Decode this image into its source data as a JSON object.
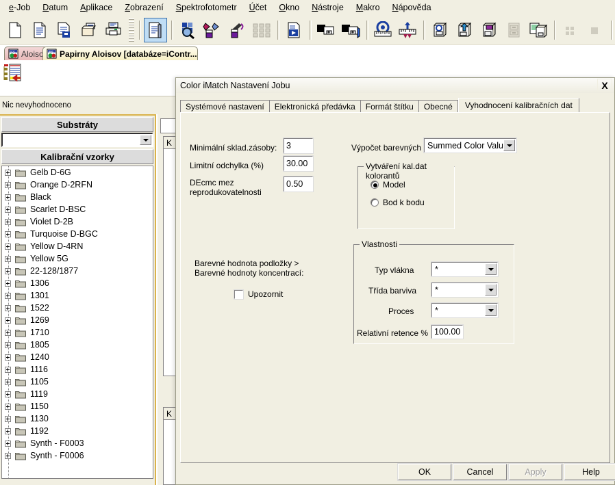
{
  "menubar": {
    "items": [
      {
        "label": "e-Job",
        "accel": "e"
      },
      {
        "label": "Datum",
        "accel": "D"
      },
      {
        "label": "Aplikace",
        "accel": "A"
      },
      {
        "label": "Zobrazení",
        "accel": "Z"
      },
      {
        "label": "Spektrofotometr",
        "accel": "S"
      },
      {
        "label": "Účet",
        "accel": "Ú"
      },
      {
        "label": "Okno",
        "accel": "O"
      },
      {
        "label": "Nástroje",
        "accel": "N"
      },
      {
        "label": "Makro",
        "accel": "M"
      },
      {
        "label": "Nápověda",
        "accel": "N"
      }
    ]
  },
  "toolbar": {
    "buttons": [
      {
        "icon": "new-document-icon",
        "selected": false
      },
      {
        "icon": "open-document-icon",
        "selected": false
      },
      {
        "icon": "save-document-icon",
        "selected": false
      },
      {
        "icon": "print-preview-icon",
        "selected": false
      },
      {
        "icon": "print-icon",
        "selected": false
      },
      {
        "icon": "job-document-icon",
        "selected": true
      },
      {
        "icon": "color-search-icon",
        "selected": false
      },
      {
        "icon": "color-mix-icon",
        "selected": false
      },
      {
        "icon": "pipette-sample-icon",
        "selected": false
      },
      {
        "icon": "columns-grid-icon",
        "selected": false
      },
      {
        "icon": "run-document-icon",
        "selected": false
      },
      {
        "icon": "monitor-measure-icon",
        "selected": false
      },
      {
        "icon": "monitor-edit-icon",
        "selected": false
      },
      {
        "icon": "target-ruler-icon",
        "selected": false
      },
      {
        "icon": "tolerance-ruler-icon",
        "selected": false
      },
      {
        "icon": "database-target-icon",
        "selected": false
      },
      {
        "icon": "database-import-icon",
        "selected": false
      },
      {
        "icon": "database-color-icon",
        "selected": false
      },
      {
        "icon": "cabinet-icon",
        "selected": false
      },
      {
        "icon": "report-database-icon",
        "selected": false
      },
      {
        "icon": "grid-small-icon",
        "selected": false
      },
      {
        "icon": "grid-block-icon",
        "selected": false
      },
      {
        "icon": "mail-icon",
        "selected": false
      }
    ]
  },
  "doctabs": [
    {
      "label": "Aloisov",
      "active": false,
      "icon": "doc-globe-icon"
    },
    {
      "label": "Papirny Aloisov [databáze=iContr...",
      "active": true,
      "icon": "doc-globe-icon"
    }
  ],
  "status": {
    "text": "Nic nevyhodnoceno"
  },
  "leftpanel": {
    "substrates": {
      "header": "Substráty",
      "selected_value": "",
      "placeholder": ""
    },
    "calibration": {
      "header": "Kalibrační vzorky",
      "items": [
        "Gelb D-6G",
        "Orange D-2RFN",
        "Black",
        "Scarlet D-BSC",
        "Violet D-2B",
        "Turquoise D-BGC",
        "Yellow D-4RN",
        "Yellow 5G",
        "22-128/1877",
        "1306",
        "1301",
        "1522",
        "1269",
        "1710",
        "1805",
        "1240",
        "1116",
        "1105",
        "1119",
        "1150",
        "1130",
        "1192",
        "Synth - F0003",
        "Synth - F0006"
      ]
    }
  },
  "background_panels": {
    "tab_labels": [
      "K",
      "K"
    ]
  },
  "dialog": {
    "title": "Color iMatch Nastavení Jobu",
    "close_label": "X",
    "tabs": [
      {
        "label": "Systémové nastavení",
        "active": false
      },
      {
        "label": "Elektronická předávka",
        "active": false
      },
      {
        "label": "Formát štítku",
        "active": false
      },
      {
        "label": "Obecné",
        "active": false
      },
      {
        "label": "Vyhodnocení kalibračních dat",
        "active": true
      }
    ],
    "fields": {
      "min_stock_label": "Minimální sklad.zásoby:",
      "min_stock_value": "3",
      "limit_deviation_label": "Limitní odchylka (%)",
      "limit_deviation_value": "30.00",
      "decmc_label": "DEcmc mez reprodukovatelnosti",
      "decmc_value": "0.50",
      "color_calc_label": "Výpočet barevných hodnot:",
      "color_calc_value": "Summed Color Value",
      "warning_text": "Barevné hodnota podložky > Barevné hodnoty koncentrací:",
      "warning_checkbox_label": "Upozornit",
      "warning_checkbox_checked": false
    },
    "colorant_group": {
      "title": "Vytváření kal.dat kolorantů",
      "options": [
        {
          "label": "Model",
          "selected": true
        },
        {
          "label": "Bod k bodu",
          "selected": false
        }
      ]
    },
    "properties_group": {
      "title": "Vlastnosti",
      "rows": [
        {
          "label": "Typ vlákna",
          "value": "*",
          "type": "dropdown"
        },
        {
          "label": "Třída barviva",
          "value": "*",
          "type": "dropdown"
        },
        {
          "label": "Proces",
          "value": "*",
          "type": "dropdown"
        }
      ],
      "retention_label": "Relativní retence %",
      "retention_value": "100.00"
    },
    "buttons": [
      {
        "label": "OK",
        "enabled": true
      },
      {
        "label": "Cancel",
        "enabled": true
      },
      {
        "label": "Apply",
        "enabled": false
      },
      {
        "label": "Help",
        "enabled": true
      }
    ]
  },
  "colors": {
    "window_bg": "#f1efe2",
    "panel_border": "#d9b24a",
    "toolbar_selected": "#bfddf5",
    "tab_active": "#f6eec2",
    "tab_inactive": "#e8b9b9"
  }
}
